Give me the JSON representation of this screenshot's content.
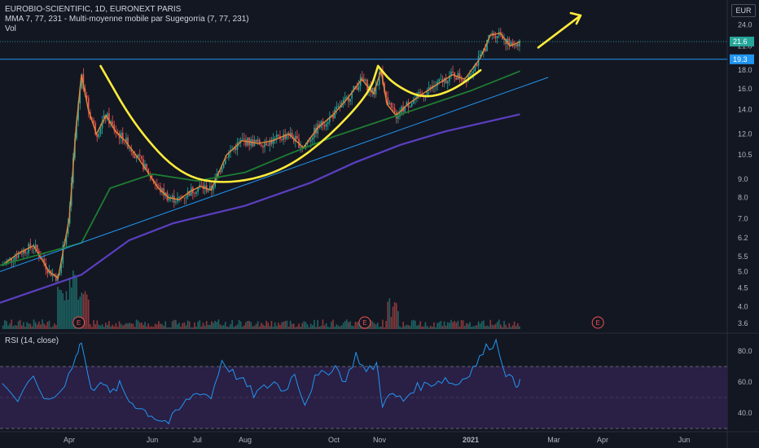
{
  "header": {
    "title": "EUROBIO-SCIENTIFIC, 1D, EURONEXT PARIS",
    "indicator": "MMA 7, 77, 231 - Multi-moyenne mobile par Sugegorria (7, 77, 231)",
    "volume": "Vol",
    "currency": "EUR"
  },
  "rsi_label": "RSI (14, close)",
  "colors": {
    "background": "#131722",
    "up": "#26a69a",
    "down": "#ef5350",
    "ma7": "#e0883a",
    "ma77": "#1e7d32",
    "ma231": "#5b3fc0",
    "trendline": "#2196f3",
    "annotation": "#ffeb3b",
    "rsi_line": "#2196f3",
    "rsi_band": "#2a1f45",
    "earnings": "#ef5350"
  },
  "chart_data": [
    {
      "type": "candlestick",
      "title": "EUROBIO-SCIENTIFIC, 1D, EURONEXT PARIS",
      "x_ticks": [
        "Apr",
        "Jun",
        "Jul",
        "Aug",
        "Oct",
        "Nov",
        "2021",
        "Mar",
        "Apr",
        "Jun"
      ],
      "y_scale": "log",
      "y_ticks": [
        3.6,
        4.0,
        4.5,
        5.0,
        5.5,
        6.2,
        7.0,
        8.0,
        9.0,
        10.5,
        12.0,
        14.0,
        16.0,
        18.0,
        21.0,
        24.0
      ],
      "ylim": [
        3.45,
        27
      ],
      "price_labels": [
        {
          "value": 21.6,
          "text": "21.6"
        },
        {
          "value": 19.3,
          "text": "19.3"
        }
      ],
      "horizontal_line": 19.3,
      "series": [
        {
          "name": "MMA 7",
          "type": "line"
        },
        {
          "name": "MMA 77",
          "type": "line"
        },
        {
          "name": "MMA 231",
          "type": "line"
        }
      ],
      "close_path": [
        [
          "2020-03-02",
          5.2
        ],
        [
          "2020-03-09",
          5.6
        ],
        [
          "2020-03-16",
          5.9
        ],
        [
          "2020-03-23",
          5.0
        ],
        [
          "2020-03-27",
          4.8
        ],
        [
          "2020-04-01",
          7.0
        ],
        [
          "2020-04-06",
          12.5
        ],
        [
          "2020-04-10",
          17.5
        ],
        [
          "2020-04-15",
          14.0
        ],
        [
          "2020-04-21",
          12.0
        ],
        [
          "2020-04-28",
          13.5
        ],
        [
          "2020-05-05",
          12.2
        ],
        [
          "2020-05-12",
          11.5
        ],
        [
          "2020-05-20",
          10.5
        ],
        [
          "2020-05-28",
          9.5
        ],
        [
          "2020-06-05",
          8.5
        ],
        [
          "2020-06-12",
          8.0
        ],
        [
          "2020-06-19",
          7.9
        ],
        [
          "2020-06-26",
          8.3
        ],
        [
          "2020-07-03",
          8.6
        ],
        [
          "2020-07-10",
          8.4
        ],
        [
          "2020-07-20",
          10.5
        ],
        [
          "2020-07-30",
          11.5
        ],
        [
          "2020-08-10",
          11.3
        ],
        [
          "2020-08-20",
          11.5
        ],
        [
          "2020-08-31",
          12.0
        ],
        [
          "2020-09-10",
          11.0
        ],
        [
          "2020-09-20",
          12.5
        ],
        [
          "2020-09-30",
          13.5
        ],
        [
          "2020-10-10",
          15.0
        ],
        [
          "2020-10-20",
          17.0
        ],
        [
          "2020-10-28",
          15.5
        ],
        [
          "2020-11-02",
          18.0
        ],
        [
          "2020-11-06",
          14.5
        ],
        [
          "2020-11-12",
          13.5
        ],
        [
          "2020-11-20",
          14.5
        ],
        [
          "2020-11-30",
          15.5
        ],
        [
          "2020-12-10",
          16.5
        ],
        [
          "2020-12-20",
          17.5
        ],
        [
          "2020-12-28",
          17.0
        ],
        [
          "2021-01-08",
          19.5
        ],
        [
          "2021-01-15",
          22.5
        ],
        [
          "2021-01-22",
          22.8
        ],
        [
          "2021-01-29",
          21.0
        ],
        [
          "2021-02-05",
          21.6
        ]
      ],
      "ma77_path": [
        [
          "2020-03-01",
          5.2
        ],
        [
          "2020-04-10",
          6.0
        ],
        [
          "2020-05-01",
          8.5
        ],
        [
          "2020-06-01",
          9.3
        ],
        [
          "2020-07-01",
          8.9
        ],
        [
          "2020-08-01",
          9.4
        ],
        [
          "2020-09-01",
          10.6
        ],
        [
          "2020-10-01",
          11.8
        ],
        [
          "2020-11-01",
          13.0
        ],
        [
          "2020-12-01",
          14.3
        ],
        [
          "2021-01-01",
          15.8
        ],
        [
          "2021-02-05",
          17.9
        ]
      ],
      "ma231_path": [
        [
          "2020-03-01",
          4.1
        ],
        [
          "2020-04-10",
          4.9
        ],
        [
          "2020-05-15",
          6.1
        ],
        [
          "2020-06-15",
          6.8
        ],
        [
          "2020-08-01",
          7.6
        ],
        [
          "2020-09-15",
          8.8
        ],
        [
          "2020-10-15",
          10.0
        ],
        [
          "2020-11-15",
          11.2
        ],
        [
          "2020-12-15",
          12.2
        ],
        [
          "2021-02-05",
          13.6
        ]
      ],
      "trendline": [
        [
          "2020-03-01",
          5.0
        ],
        [
          "2021-02-25",
          17.2
        ]
      ],
      "earnings_markers": [
        "2020-04-08",
        "2020-10-22",
        "2021-03-29"
      ],
      "earnings_label": "E",
      "annotations": [
        "cup-and-handle pattern",
        "upward arrow"
      ]
    },
    {
      "type": "line",
      "title": "RSI (14, close)",
      "ylim": [
        30,
        90
      ],
      "y_ticks": [
        40.0,
        60.0,
        80.0
      ],
      "band": [
        30,
        70
      ],
      "rsi_path": [
        [
          "2020-03-02",
          60
        ],
        [
          "2020-03-09",
          48
        ],
        [
          "2020-03-16",
          62
        ],
        [
          "2020-03-23",
          46
        ],
        [
          "2020-03-30",
          58
        ],
        [
          "2020-04-06",
          78
        ],
        [
          "2020-04-10",
          86
        ],
        [
          "2020-04-17",
          54
        ],
        [
          "2020-04-24",
          62
        ],
        [
          "2020-05-01",
          52
        ],
        [
          "2020-05-08",
          58
        ],
        [
          "2020-05-15",
          48
        ],
        [
          "2020-05-22",
          44
        ],
        [
          "2020-05-29",
          40
        ],
        [
          "2020-06-05",
          36
        ],
        [
          "2020-06-12",
          34
        ],
        [
          "2020-06-19",
          42
        ],
        [
          "2020-06-26",
          50
        ],
        [
          "2020-07-03",
          54
        ],
        [
          "2020-07-10",
          50
        ],
        [
          "2020-07-17",
          74
        ],
        [
          "2020-07-24",
          66
        ],
        [
          "2020-07-31",
          60
        ],
        [
          "2020-08-07",
          52
        ],
        [
          "2020-08-14",
          56
        ],
        [
          "2020-08-21",
          60
        ],
        [
          "2020-08-28",
          54
        ],
        [
          "2020-09-04",
          66
        ],
        [
          "2020-09-11",
          46
        ],
        [
          "2020-09-18",
          62
        ],
        [
          "2020-09-25",
          66
        ],
        [
          "2020-10-02",
          70
        ],
        [
          "2020-10-09",
          60
        ],
        [
          "2020-10-16",
          78
        ],
        [
          "2020-10-23",
          66
        ],
        [
          "2020-10-30",
          72
        ],
        [
          "2020-11-03",
          46
        ],
        [
          "2020-11-10",
          52
        ],
        [
          "2020-11-17",
          48
        ],
        [
          "2020-11-24",
          56
        ],
        [
          "2020-12-01",
          58
        ],
        [
          "2020-12-08",
          60
        ],
        [
          "2020-12-15",
          62
        ],
        [
          "2020-12-22",
          58
        ],
        [
          "2020-12-29",
          64
        ],
        [
          "2021-01-05",
          72
        ],
        [
          "2021-01-12",
          82
        ],
        [
          "2021-01-19",
          86
        ],
        [
          "2021-01-26",
          66
        ],
        [
          "2021-02-02",
          58
        ],
        [
          "2021-02-05",
          62
        ]
      ]
    }
  ]
}
